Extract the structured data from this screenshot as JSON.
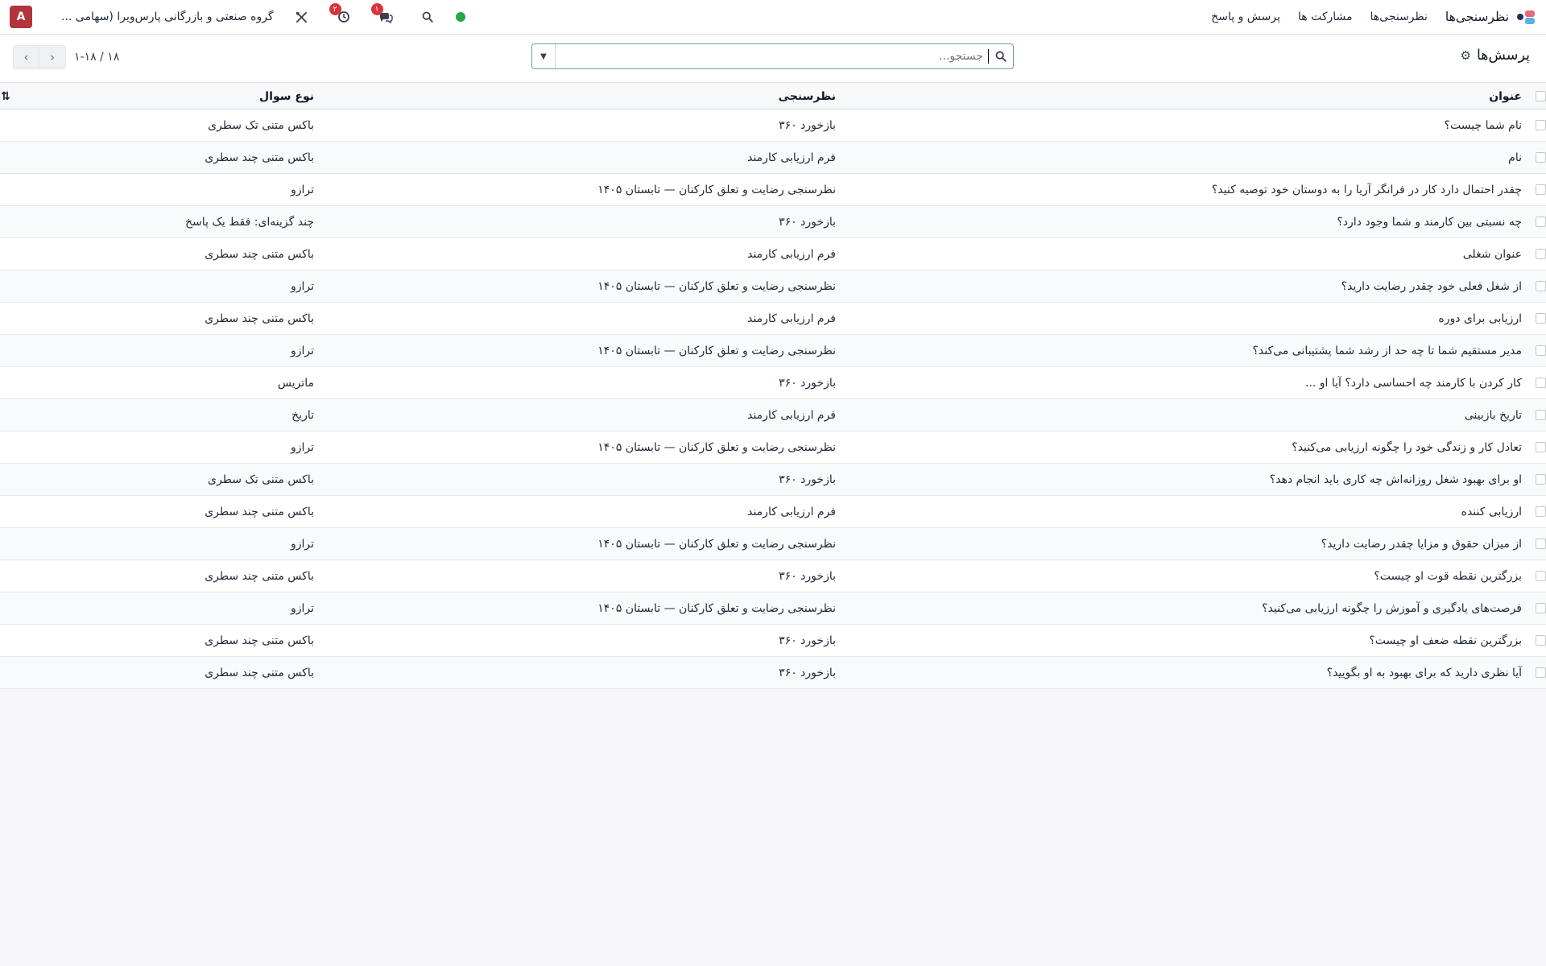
{
  "topbar": {
    "app_name": "نظرسنجی‌ها",
    "nav": [
      "نظرسنجی‌ها",
      "مشارکت ها",
      "پرسش و پاسخ"
    ],
    "company": "گروه صنعتی و بازرگانی پارس‌ویرا (سهامی ...",
    "avatar_letter": "A",
    "messages_badge": "۱",
    "activities_badge": "۲",
    "icons": [
      "status-dot-icon",
      "search-icon",
      "chat-icon",
      "clock-icon",
      "tools-icon"
    ]
  },
  "control": {
    "breadcrumb_title": "پرسش‌ها",
    "search_placeholder": "جستجو...",
    "pager_value": "۱-۱۸ / ۱۸"
  },
  "table": {
    "columns": {
      "title": "عنوان",
      "survey": "نظرسنجی",
      "type": "نوع سوال"
    },
    "rows": [
      {
        "title": "نام شما چیست؟",
        "survey": "بازخورد ۳۶۰",
        "type": "باکس متنی تک سطری"
      },
      {
        "title": "نام",
        "survey": "فرم ارزیابی کارمند",
        "type": "باکس متنی چند سطری"
      },
      {
        "title": "چقدر احتمال دارد کار در فرانگر آریا را به دوستان خود توصیه کنید؟",
        "survey": "نظرسنجی رضایت و تعلق کارکنان — تابستان ۱۴۰۵",
        "type": "ترازو"
      },
      {
        "title": "چه نسبتی بین کارمند و شما وجود دارد؟",
        "survey": "بازخورد ۳۶۰",
        "type": "چند گزینه‌ای: فقط یک پاسخ"
      },
      {
        "title": "عنوان شغلی",
        "survey": "فرم ارزیابی کارمند",
        "type": "باکس متنی چند سطری"
      },
      {
        "title": "از شغل فعلی خود چقدر رضایت دارید؟",
        "survey": "نظرسنجی رضایت و تعلق کارکنان — تابستان ۱۴۰۵",
        "type": "ترازو"
      },
      {
        "title": "ارزیابی برای دوره",
        "survey": "فرم ارزیابی کارمند",
        "type": "باکس متنی چند سطری"
      },
      {
        "title": "مدیر مستقیم شما تا چه حد از رشد شما پشتیبانی می‌کند؟",
        "survey": "نظرسنجی رضایت و تعلق کارکنان — تابستان ۱۴۰۵",
        "type": "ترازو"
      },
      {
        "title": "کار کردن با کارمند چه احساسی دارد؟ آیا او ...",
        "survey": "بازخورد ۳۶۰",
        "type": "ماتریس"
      },
      {
        "title": "تاریخ بازبینی",
        "survey": "فرم ارزیابی کارمند",
        "type": "تاریخ"
      },
      {
        "title": "تعادل کار و زندگی خود را چگونه ارزیابی می‌کنید؟",
        "survey": "نظرسنجی رضایت و تعلق کارکنان — تابستان ۱۴۰۵",
        "type": "ترازو"
      },
      {
        "title": "او برای بهبود شغل روزانه‌اش چه کاری باید انجام دهد؟",
        "survey": "بازخورد ۳۶۰",
        "type": "باکس متنی تک سطری"
      },
      {
        "title": "ارزیابی کننده",
        "survey": "فرم ارزیابی کارمند",
        "type": "باکس متنی چند سطری"
      },
      {
        "title": "از میزان حقوق و مزایا چقدر رضایت دارید؟",
        "survey": "نظرسنجی رضایت و تعلق کارکنان — تابستان ۱۴۰۵",
        "type": "ترازو"
      },
      {
        "title": "بزرگترین نقطه قوت او چیست؟",
        "survey": "بازخورد ۳۶۰",
        "type": "باکس متنی چند سطری"
      },
      {
        "title": "فرصت‌های یادگیری و آموزش را چگونه ارزیابی می‌کنید؟",
        "survey": "نظرسنجی رضایت و تعلق کارکنان — تابستان ۱۴۰۵",
        "type": "ترازو"
      },
      {
        "title": "بزرگترین نقطه ضعف او چیست؟",
        "survey": "بازخورد ۳۶۰",
        "type": "باکس متنی چند سطری"
      },
      {
        "title": "آیا نظری دارید که برای بهبود به او بگویید؟",
        "survey": "بازخورد ۳۶۰",
        "type": "باکس متنی چند سطری"
      }
    ]
  }
}
